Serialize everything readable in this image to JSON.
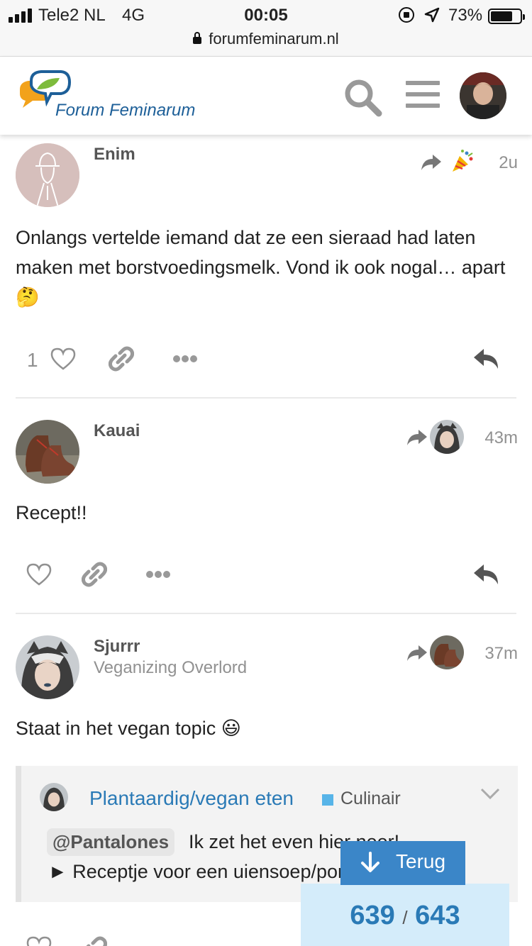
{
  "status_bar": {
    "carrier": "Tele2 NL",
    "network": "4G",
    "time": "00:05",
    "battery": "73%",
    "url": "forumfeminarum.nl"
  },
  "header": {
    "site_name": "Forum Feminarum",
    "icons": [
      "search-icon",
      "hamburger-menu-icon",
      "user-avatar"
    ]
  },
  "posts": [
    {
      "username": "Enim",
      "time": "2u",
      "reply_to_icon": "party-popper-emoji",
      "body": "Onlangs vertelde iemand dat ze een sieraad had laten maken met borstvoedingsmelk. Vond ik ook nogal… apart",
      "emoji": "🤔",
      "like_count": "1"
    },
    {
      "username": "Kauai",
      "time": "43m",
      "body": "Recept!!"
    },
    {
      "username": "Sjurrr",
      "user_title": "Veganizing Overlord",
      "time": "37m",
      "body": "Staat in het vegan topic",
      "emoji": "😃",
      "onebox": {
        "title": "Plantaardig/vegan eten",
        "category": "Culinair",
        "mention": "@Pantalones",
        "line1": "Ik zet het even hier neer!",
        "line2": "► Receptje voor een uiensoep/pompoensoep"
      }
    }
  ],
  "colors": {
    "accent": "#3b86c8",
    "link": "#2a7ab6",
    "category": "#57b4e8",
    "counter_bg": "#d4ecfa"
  },
  "navigation": {
    "back_label": "Terug",
    "current": "639",
    "total": "643"
  }
}
